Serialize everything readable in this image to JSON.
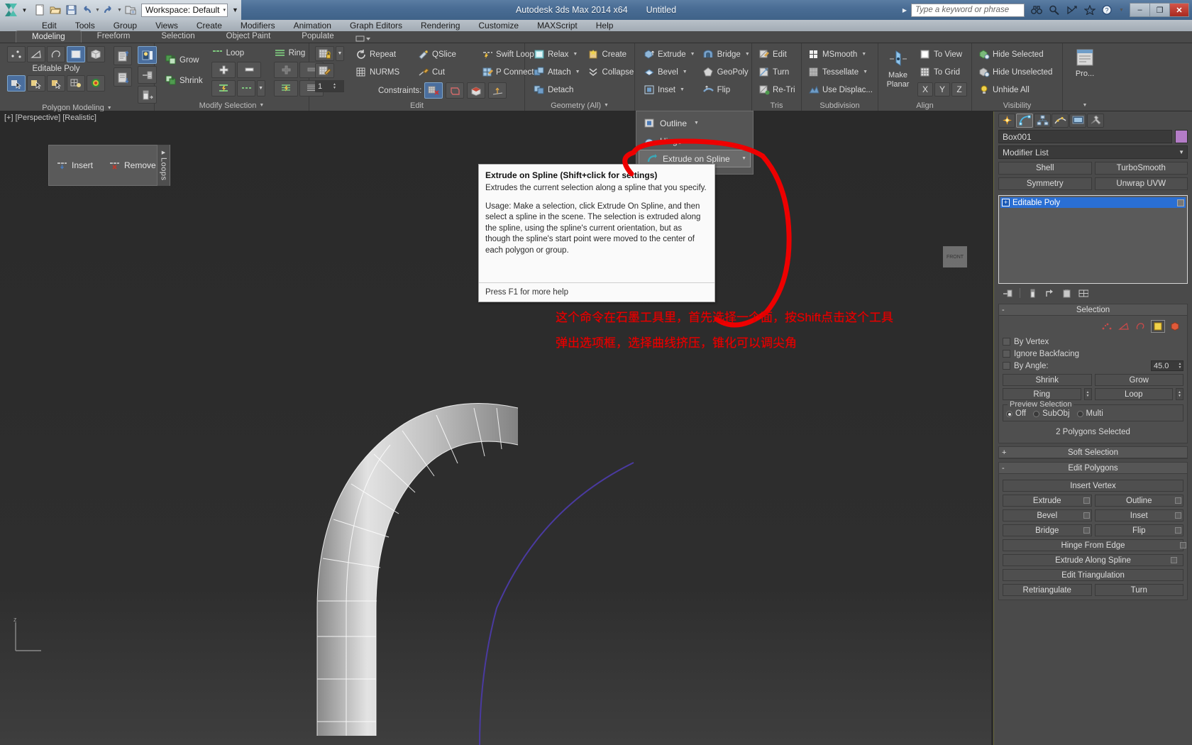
{
  "titlebar": {
    "workspace_label": "Workspace: Default",
    "app_title": "Autodesk 3ds Max  2014 x64",
    "document_title": "Untitled",
    "search_placeholder": "Type a keyword or phrase",
    "qat": [
      "new-icon",
      "open-icon",
      "save-icon",
      "undo-icon",
      "redo-icon",
      "set-project-folder-icon"
    ],
    "right_icons": [
      "binoculars-icon",
      "magnifier-icon",
      "satellite-icon",
      "star-icon",
      "help-icon"
    ],
    "window_buttons": [
      "–",
      "❐",
      "✕"
    ]
  },
  "menubar": {
    "items": [
      "Edit",
      "Tools",
      "Group",
      "Views",
      "Create",
      "Modifiers",
      "Animation",
      "Graph Editors",
      "Rendering",
      "Customize",
      "MAXScript",
      "Help"
    ]
  },
  "ribbon": {
    "tabs": [
      "Modeling",
      "Freeform",
      "Selection",
      "Object Paint",
      "Populate"
    ],
    "active_tab": "Modeling",
    "panels": {
      "polygon_modeling": {
        "title": "Polygon Modeling",
        "label": "Editable Poly",
        "subobject_icons": [
          "vertex-icon",
          "edge-icon",
          "border-icon",
          "polygon-icon",
          "element-icon"
        ],
        "stack_icons": [
          "generate-topology-icon",
          "repeat-last-icon",
          "paint-connect-icon"
        ],
        "mode_icons": [
          "use-stack-selection-icon",
          "pin-stack-icon",
          "show-end-result-icon"
        ],
        "tool_icons": [
          "poly-select-icon",
          "poly-soft-select-icon",
          "poly-paint-select-icon",
          "poly-preserve-uv-icon",
          "soft-selection-icon"
        ]
      },
      "modify_selection": {
        "title": "Modify Selection",
        "buttons": [
          "Grow",
          "Shrink",
          "Loop",
          "Ring"
        ],
        "icons": [
          "grow-icon",
          "shrink-icon",
          "loop-icon",
          "ring-icon",
          "loop-grow-icon",
          "loop-shift-icon",
          "ring-grow-icon",
          "ring-shift-icon",
          "dot-loop-icon",
          "dot-ring-icon"
        ]
      },
      "edit": {
        "title": "Edit",
        "buttons": [
          "Repeat",
          "QSlice",
          "Swift Loop",
          "NURMS",
          "Cut",
          "P Connect"
        ],
        "constraints_label": "Constraints:",
        "constraint_icons": [
          "constraint-none-icon",
          "constraint-edge-icon",
          "constraint-face-icon",
          "constraint-normal-icon"
        ],
        "stepper_value": "1",
        "left_icons": [
          "lock-grid-icon",
          "paint-deform-icon"
        ]
      },
      "geometry_all": {
        "title": "Geometry (All)",
        "buttons": [
          "Relax",
          "Attach",
          "Detach",
          "Create",
          "Collapse"
        ],
        "icons": [
          "relax-icon",
          "attach-icon",
          "detach-icon",
          "create-icon",
          "collapse-icon"
        ]
      },
      "polygons": {
        "title": "",
        "buttons": [
          "Extrude",
          "Bevel",
          "Inset",
          "Bridge",
          "GeoPoly",
          "Flip"
        ],
        "icons": [
          "extrude-icon",
          "bevel-icon",
          "inset-icon",
          "bridge-icon",
          "geopoly-icon",
          "flip-icon"
        ]
      },
      "tris": {
        "title": "Tris",
        "buttons": [
          "Edit",
          "Turn",
          "Re-Tri"
        ],
        "icons": [
          "edit-tri-icon",
          "turn-tri-icon",
          "retriangulate-icon"
        ]
      },
      "subdivision": {
        "title": "Subdivision",
        "buttons": [
          "MSmooth",
          "Tessellate",
          "Use Displac..."
        ],
        "icons": [
          "msmooth-icon",
          "tessellate-icon",
          "use-displacement-icon"
        ]
      },
      "align": {
        "title": "Align",
        "make_planar_label": "Make\nPlanar",
        "make_planar_line1": "Make",
        "make_planar_line2": "Planar",
        "buttons": [
          "To View",
          "To Grid"
        ],
        "axes": [
          "X",
          "Y",
          "Z"
        ],
        "icons": [
          "make-planar-icon",
          "align-to-view-icon",
          "align-to-grid-icon"
        ]
      },
      "visibility": {
        "title": "Visibility",
        "buttons": [
          "Hide Selected",
          "Hide Unselected",
          "Unhide All"
        ],
        "icons": [
          "hide-selected-icon",
          "hide-unselected-icon",
          "unhide-all-icon"
        ]
      },
      "properties": {
        "label": "Pro...",
        "icon": "properties-icon"
      }
    }
  },
  "viewport": {
    "label": "[+] [Perspective] [Realistic]",
    "viewcube_label": "FRONT",
    "axis_z": "z",
    "loops_toolbar": {
      "items": [
        "Insert",
        "Remove"
      ],
      "tab_label": "Loops",
      "icons": [
        "insert-loop-icon",
        "remove-loop-icon"
      ]
    }
  },
  "flyout": {
    "items": [
      {
        "label": "Outline",
        "icon": "outline-icon",
        "has_caret": true,
        "highlighted": false
      },
      {
        "label": "Hinge",
        "icon": "hinge-icon",
        "has_caret": true,
        "highlighted": false
      },
      {
        "label": "Extrude  on Spline",
        "icon": "extrude-on-spline-icon",
        "has_caret": true,
        "highlighted": true
      }
    ]
  },
  "tooltip": {
    "title": "Extrude on Spline  (Shift+click for settings)",
    "paragraph1": "Extrudes the current selection along a spline that you specify.",
    "paragraph2": "Usage: Make a selection, click Extrude On Spline, and then select a spline in the scene. The selection is extruded along the spline, using the spline's current orientation, but as though the spline's start point were moved to the center of each polygon or group.",
    "footer": "Press F1 for more help"
  },
  "annotations": {
    "line1": "这个命令在石墨工具里，首先选择一个面，按Shift点击这个工具",
    "line2": "弹出选项框，选择曲线挤压，锥化可以调尖角",
    "color": "#e60000"
  },
  "command_panel": {
    "tabs": [
      "create-tab-icon",
      "modify-tab-icon",
      "hierarchy-tab-icon",
      "motion-tab-icon",
      "display-tab-icon",
      "utilities-tab-icon"
    ],
    "active_tab_index": 1,
    "object_name": "Box001",
    "object_color": "#b47cc7",
    "modifier_list_label": "Modifier List",
    "modifier_buttons": [
      "Shell",
      "TurboSmooth",
      "Symmetry",
      "Unwrap UVW"
    ],
    "modifier_stack": [
      {
        "label": "Editable Poly",
        "selected": true
      }
    ],
    "stack_tool_icons": [
      "pin-stack-icon",
      "show-end-result-icon",
      "make-unique-icon",
      "remove-modifier-icon",
      "configure-sets-icon"
    ],
    "rollouts": [
      {
        "name": "Selection",
        "collapsed": false,
        "subobject_icons": [
          "vertex-icon",
          "edge-icon",
          "border-icon",
          "polygon-icon",
          "element-icon"
        ],
        "active_subobject_index": 3,
        "checkboxes": [
          {
            "label": "By Vertex",
            "checked": false
          },
          {
            "label": "Ignore Backfacing",
            "checked": false
          },
          {
            "label": "By Angle:",
            "checked": false,
            "value": "45.0"
          }
        ],
        "buttons": [
          "Shrink",
          "Grow",
          "Ring",
          "Loop"
        ],
        "preview_selection_label": "Preview Selection",
        "preview_options": [
          "Off",
          "SubObj",
          "Multi"
        ],
        "preview_selected": "Off",
        "status": "2 Polygons Selected"
      },
      {
        "name": "Soft Selection",
        "collapsed": true
      },
      {
        "name": "Edit Polygons",
        "collapsed": false,
        "buttons_full": [
          "Insert Vertex",
          "Hinge From Edge",
          "Extrude Along Spline",
          "Edit Triangulation"
        ],
        "buttons_pairs": [
          [
            "Extrude",
            "Outline"
          ],
          [
            "Bevel",
            "Inset"
          ],
          [
            "Bridge",
            "Flip"
          ]
        ],
        "buttons_bottom": [
          "Retriangulate",
          "Turn"
        ]
      }
    ]
  }
}
